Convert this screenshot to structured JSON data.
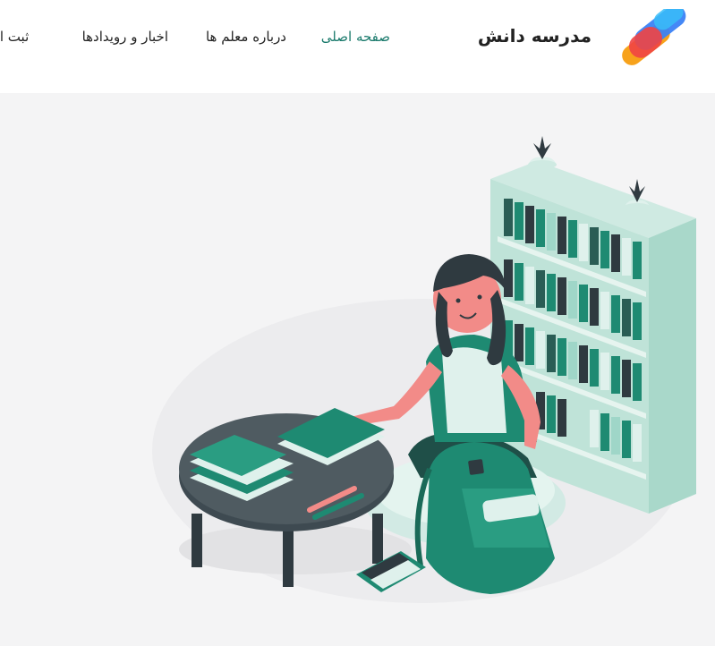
{
  "header": {
    "brand": "مدرسه دانش",
    "nav": [
      {
        "label": "صفحه اصلی",
        "active": true
      },
      {
        "label": "درباره معلم ها",
        "active": false
      },
      {
        "label": "اخبار و رویدادها",
        "active": false
      },
      {
        "label": "ثبت اط",
        "active": false
      }
    ]
  },
  "colors": {
    "accent": "#1a7a6c",
    "primary_teal": "#1e8a72",
    "hero_bg": "#f4f4f5"
  }
}
